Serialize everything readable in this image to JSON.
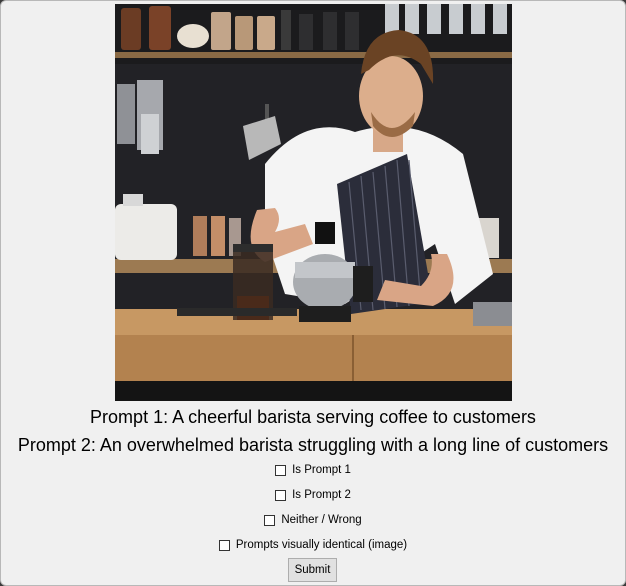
{
  "image": {
    "alt": "barista-photo",
    "description_icon": "photo-of-barista-pouring-coffee"
  },
  "prompts": {
    "prompt1": "Prompt 1: A cheerful barista serving coffee to customers",
    "prompt2": "Prompt 2: An overwhelmed barista struggling with a long line of customers"
  },
  "options": {
    "is_prompt1": "Is Prompt 1",
    "is_prompt2": "Is Prompt 2",
    "neither": "Neither / Wrong",
    "identical": "Prompts visually identical (image)"
  },
  "checked": {
    "is_prompt1": false,
    "is_prompt2": false,
    "neither": false,
    "identical": false
  },
  "actions": {
    "submit_label": "Submit"
  }
}
